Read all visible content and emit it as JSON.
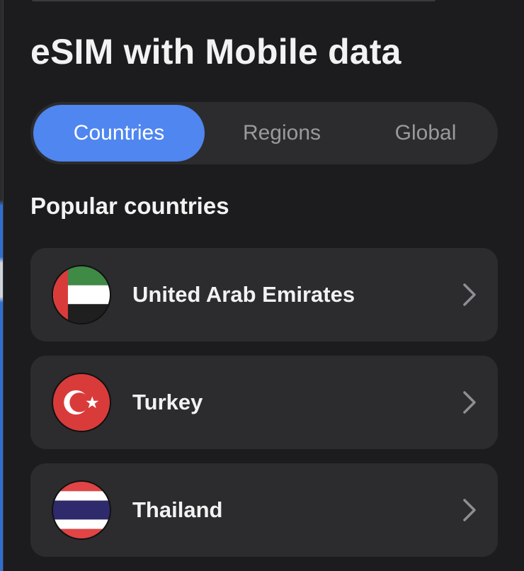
{
  "header": {
    "title": "eSIM with Mobile data"
  },
  "tabs": [
    {
      "label": "Countries",
      "active": true
    },
    {
      "label": "Regions",
      "active": false
    },
    {
      "label": "Global",
      "active": false
    }
  ],
  "popular": {
    "heading": "Popular countries",
    "items": [
      {
        "name": "United Arab Emirates",
        "flag_icon": "uae-flag-icon"
      },
      {
        "name": "Turkey",
        "flag_icon": "turkey-flag-icon"
      },
      {
        "name": "Thailand",
        "flag_icon": "thailand-flag-icon"
      }
    ]
  },
  "colors": {
    "background": "#1c1c1e",
    "card": "#2c2c2e",
    "accent": "#4f86f0",
    "text": "#f2f2f2",
    "muted": "#9a9a9e"
  }
}
